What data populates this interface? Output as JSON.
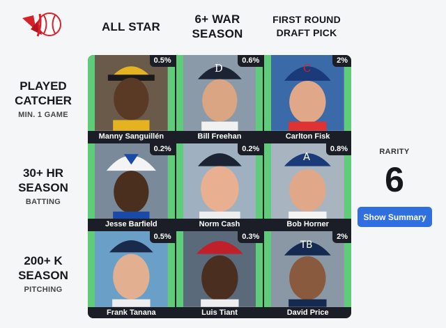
{
  "brand": {
    "logo_icon": "baseball-logo-icon"
  },
  "columns": [
    {
      "label": "ALL STAR"
    },
    {
      "label": "6+ WAR SEASON"
    },
    {
      "label": "FIRST ROUND DRAFT PICK"
    }
  ],
  "rows": [
    {
      "label": "PLAYED CATCHER",
      "sub": "MIN. 1 GAME"
    },
    {
      "label": "30+ HR SEASON",
      "sub": "BATTING"
    },
    {
      "label": "200+ K SEASON",
      "sub": "PITCHING"
    }
  ],
  "cells": [
    {
      "name": "Manny Sanguillén",
      "pct": "0.5%"
    },
    {
      "name": "Bill Freehan",
      "pct": "0.6%"
    },
    {
      "name": "Carlton Fisk",
      "pct": "2%"
    },
    {
      "name": "Jesse Barfield",
      "pct": "0.2%"
    },
    {
      "name": "Norm Cash",
      "pct": "0.2%"
    },
    {
      "name": "Bob Horner",
      "pct": "0.8%"
    },
    {
      "name": "Frank Tanana",
      "pct": "0.5%"
    },
    {
      "name": "Luis Tiant",
      "pct": "0.3%"
    },
    {
      "name": "David Price",
      "pct": "2%"
    }
  ],
  "rarity": {
    "label": "RARITY",
    "value": "6"
  },
  "summary_button": {
    "label": "Show Summary"
  },
  "colors": {
    "correct": "#5fcc7a",
    "dark": "#1b1e26",
    "accent": "#2f6fe0",
    "logo": "#d8202a"
  }
}
